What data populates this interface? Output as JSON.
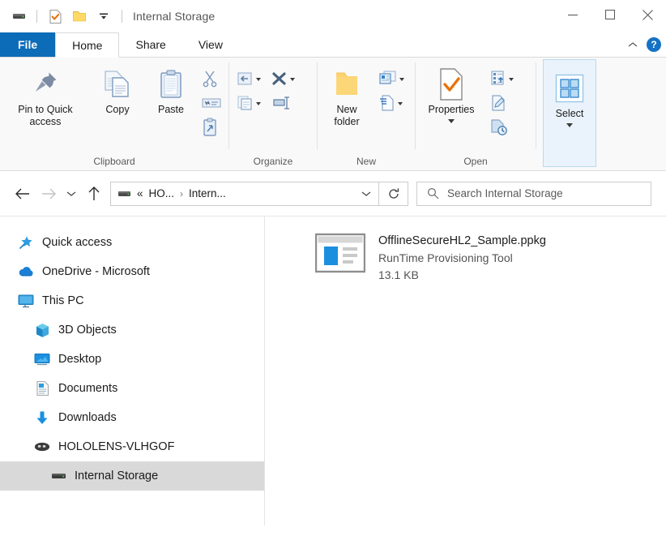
{
  "window": {
    "title": "Internal Storage",
    "quick_access_icons": [
      "drive-icon",
      "properties-check-icon",
      "new-folder-icon",
      "customize-dropdown-icon"
    ],
    "controls": {
      "minimize": "─",
      "maximize": "□",
      "close": "✕"
    }
  },
  "ribbon": {
    "tabs": [
      {
        "label": "File",
        "active": false,
        "style": "file"
      },
      {
        "label": "Home",
        "active": true,
        "style": "normal"
      },
      {
        "label": "Share",
        "active": false,
        "style": "normal"
      },
      {
        "label": "View",
        "active": false,
        "style": "normal"
      }
    ],
    "help_label": "?",
    "groups": [
      {
        "label": "Clipboard",
        "big_buttons": [
          {
            "label": "Pin to Quick\naccess",
            "line1": "Pin to Quick",
            "line2": "access",
            "icon": "pin-icon"
          },
          {
            "label": "Copy",
            "line1": "Copy",
            "line2": "",
            "icon": "copy-icon"
          },
          {
            "label": "Paste",
            "line1": "Paste",
            "line2": "",
            "icon": "paste-icon"
          }
        ],
        "small_buttons": [
          {
            "name": "cut",
            "icon": "scissors-icon"
          },
          {
            "name": "copy-path",
            "icon": "copy-path-icon"
          },
          {
            "name": "paste-shortcut",
            "icon": "paste-shortcut-icon"
          }
        ]
      },
      {
        "label": "Organize",
        "small_buttons": [
          {
            "name": "move-to",
            "icon": "move-to-icon",
            "has_caret": true
          },
          {
            "name": "copy-to",
            "icon": "copy-to-icon",
            "has_caret": true
          },
          {
            "name": "delete",
            "icon": "delete-x-icon",
            "has_caret": true
          },
          {
            "name": "rename",
            "icon": "rename-icon",
            "has_caret": false
          }
        ]
      },
      {
        "label": "New",
        "big_buttons": [
          {
            "label": "New folder",
            "line1": "New",
            "line2": "folder",
            "icon": "new-folder-icon"
          }
        ],
        "small_buttons": [
          {
            "name": "new-item",
            "icon": "new-item-icon",
            "has_caret": true
          },
          {
            "name": "easy-access",
            "icon": "easy-access-icon",
            "has_caret": true
          }
        ]
      },
      {
        "label": "Open",
        "big_buttons": [
          {
            "label": "Properties",
            "line1": "Properties",
            "line2": "",
            "icon": "properties-icon",
            "has_caret": true
          }
        ],
        "small_buttons": [
          {
            "name": "open",
            "icon": "open-icon",
            "has_caret": true
          },
          {
            "name": "edit",
            "icon": "edit-icon",
            "has_caret": false
          },
          {
            "name": "history",
            "icon": "history-icon",
            "has_caret": false
          }
        ]
      },
      {
        "label": "",
        "highlighted": true,
        "big_buttons": [
          {
            "label": "Select",
            "line1": "Select",
            "line2": "",
            "icon": "select-grid-icon",
            "has_caret": true
          }
        ]
      }
    ]
  },
  "navbar": {
    "back_icon": "arrow-left-icon",
    "forward_icon": "arrow-right-icon",
    "recent_icon": "chevron-down-icon",
    "up_icon": "arrow-up-icon",
    "breadcrumb": {
      "drive_icon": "drive-icon",
      "overflow": "«",
      "items": [
        "HO...",
        "Intern..."
      ],
      "separator": "›"
    },
    "refresh_icon": "refresh-icon",
    "search": {
      "placeholder": "Search Internal Storage",
      "icon": "search-icon",
      "value": ""
    }
  },
  "sidebar": {
    "items": [
      {
        "label": "Quick access",
        "icon": "star-pin-icon",
        "indent": 0,
        "selected": false
      },
      {
        "label": "OneDrive - Microsoft",
        "icon": "cloud-icon",
        "indent": 0,
        "selected": false
      },
      {
        "label": "This PC",
        "icon": "monitor-icon",
        "indent": 0,
        "selected": false
      },
      {
        "label": "3D Objects",
        "icon": "cube-icon",
        "indent": 1,
        "selected": false
      },
      {
        "label": "Desktop",
        "icon": "desktop-icon",
        "indent": 1,
        "selected": false
      },
      {
        "label": "Documents",
        "icon": "documents-icon",
        "indent": 1,
        "selected": false
      },
      {
        "label": "Downloads",
        "icon": "downloads-arrow-icon",
        "indent": 1,
        "selected": false
      },
      {
        "label": "HOLOLENS-VLHGOF",
        "icon": "hololens-icon",
        "indent": 1,
        "selected": false
      },
      {
        "label": "Internal Storage",
        "icon": "drive-icon",
        "indent": 2,
        "selected": true
      }
    ]
  },
  "files": [
    {
      "name": "OfflineSecureHL2_Sample.ppkg",
      "type": "RunTime Provisioning Tool",
      "size": "13.1 KB",
      "icon": "provisioning-package-icon"
    }
  ],
  "colors": {
    "file_tab_blue": "#0c6cb8",
    "selection_gray": "#d9d9d9",
    "ribbon_bg": "#f9f9f9",
    "accent_orange": "#e8730c",
    "folder_yellow": "#ffd34e",
    "highlight_blue": "#eaf3fb"
  }
}
